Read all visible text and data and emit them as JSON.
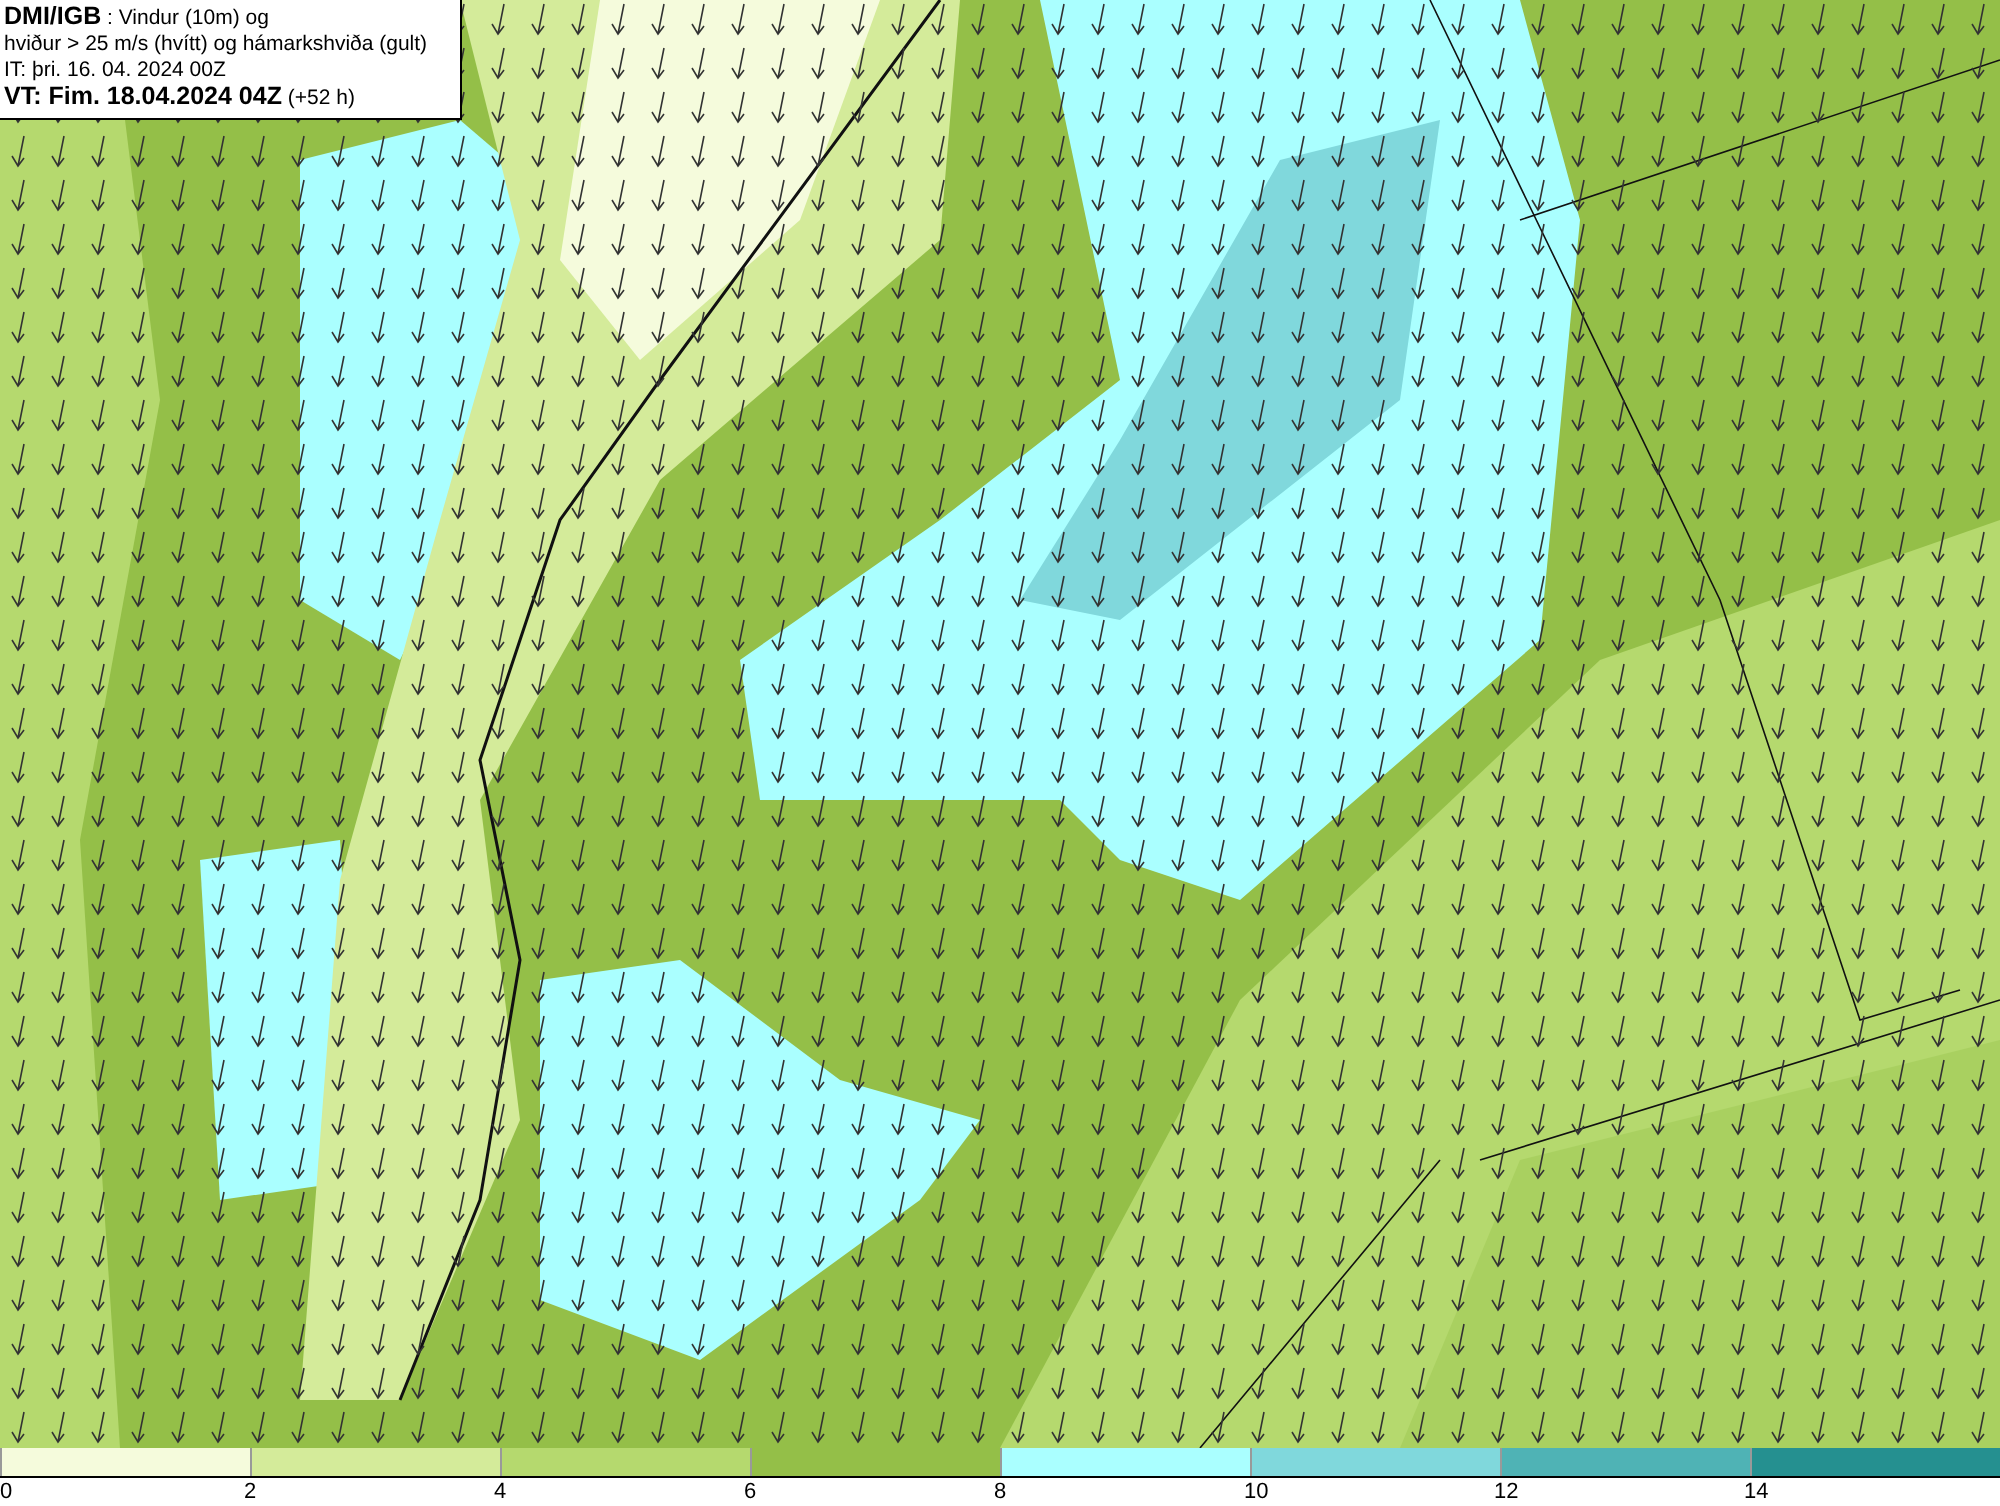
{
  "title_box": {
    "lines": [
      "**DMI/IGB** : Vindur (10m) og",
      "hviður > 25 m/s (hvítt) og hámarkshviða (gult)",
      "IT: þri. 16. 04. 2024 00Z",
      "**VT: Fim. 18.04.2024 04Z** (+52 h)"
    ]
  },
  "legend": {
    "bins": [
      {
        "color": "#f5fbdc"
      },
      {
        "color": "#d4eb9a"
      },
      {
        "color": "#b5d96e"
      },
      {
        "color": "#94bf48"
      },
      {
        "color": "#aaffff"
      },
      {
        "color": "#80d8dc"
      },
      {
        "color": "#4fb3b5"
      },
      {
        "color": "#259090"
      }
    ],
    "ticks": [
      "0",
      "2",
      "4",
      "6",
      "8",
      "10",
      "12",
      "14"
    ]
  }
}
